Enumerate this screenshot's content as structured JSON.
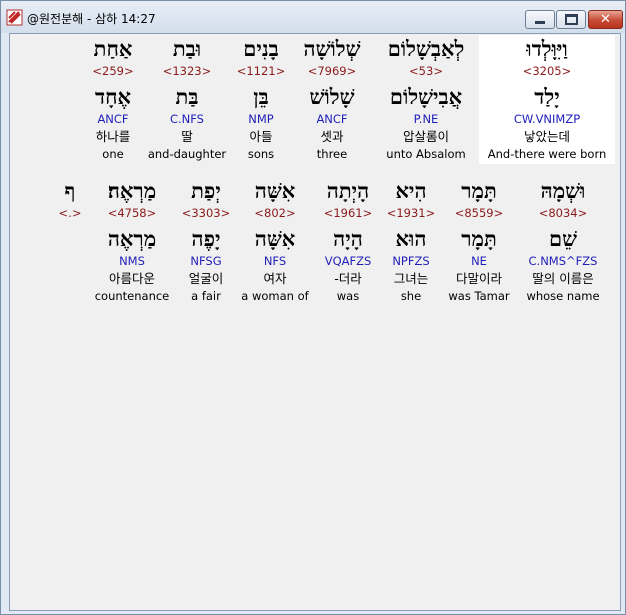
{
  "window": {
    "title": "@원전분해 - 삼하 14:27"
  },
  "rows": [
    {
      "words": [
        {
          "heb": "וַיִּוָּלְדוּ",
          "strong": "<3205>",
          "lemma": "יָלַד",
          "parse": "CW.VNIMZP",
          "korean": "낳았는데",
          "english": "And-there were born",
          "highlight": true
        },
        {
          "heb": "לְאַבְשָׁלוֹם",
          "strong": "<53>",
          "lemma": "אֲבִישָׁלוֹם",
          "parse": "P.NE",
          "korean": "압살롬이",
          "english": "unto Absalom"
        },
        {
          "heb": "שְׁלוֹשָׁה",
          "strong": "<7969>",
          "lemma": "שָׁלוֹשׁ",
          "parse": "ANCF",
          "korean": "셋과",
          "english": "three"
        },
        {
          "heb": "בָנִים",
          "strong": "<1121>",
          "lemma": "בֵּן",
          "parse": "NMP",
          "korean": "아들",
          "english": "sons"
        },
        {
          "heb": "וּבַת",
          "strong": "<1323>",
          "lemma": "בַּת",
          "parse": "C.NFS",
          "korean": "딸",
          "english": "and-daughter"
        },
        {
          "heb": "אַחַת",
          "strong": "<259>",
          "lemma": "אֶחָד",
          "parse": "ANCF",
          "korean": "하나를",
          "english": "one"
        }
      ]
    },
    {
      "words": [
        {
          "heb": "וּשְׁמָהּ",
          "strong": "<8034>",
          "lemma": "שֵׁם",
          "parse": "C.NMS^FZS",
          "korean": "딸의 이름은",
          "english": "whose name"
        },
        {
          "heb": "תָּמָר",
          "strong": "<8559>",
          "lemma": "תָּמָר",
          "parse": "NE",
          "korean": "다말이라",
          "english": "was Tamar"
        },
        {
          "heb": "הִיא",
          "strong": "<1931>",
          "lemma": "הוּא",
          "parse": "NPFZS",
          "korean": "그녀는",
          "english": "she"
        },
        {
          "heb": "הָיְתָה",
          "strong": "<1961>",
          "lemma": "הָיָה",
          "parse": "VQAFZS",
          "korean": "-더라",
          "english": "was"
        },
        {
          "heb": "אִשָּׁה",
          "strong": "<802>",
          "lemma": "אִשָּׁה",
          "parse": "NFS",
          "korean": "여자",
          "english": "a woman of"
        },
        {
          "heb": "יְפַת",
          "strong": "<3303>",
          "lemma": "יָפֶה",
          "parse": "NFSG",
          "korean": "얼굴이",
          "english": "a fair"
        },
        {
          "heb": "מַרְאֶה׃",
          "strong": "<4758>",
          "lemma": "מַרְאֶה",
          "parse": "NMS",
          "korean": "아름다운",
          "english": "countenance"
        },
        {
          "heb": "ף",
          "strong": "<.>",
          "lemma": "",
          "parse": "",
          "korean": "",
          "english": ""
        }
      ]
    }
  ]
}
